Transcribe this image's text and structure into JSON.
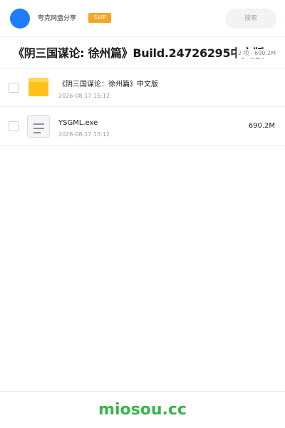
{
  "header": {
    "username": "夸克网盘分享",
    "badge": "SVIP",
    "search_placeholder": "搜索"
  },
  "folder": {
    "title": "《阴三国谋论: 徐州篇》Build.24726295中文版",
    "meta": "2 项 · 690.2M"
  },
  "files": [
    {
      "name": "《阴三国谋论：徐州篇》中文版",
      "date": "2026-08-17 15:12",
      "size": "",
      "icon": "folder-icon"
    },
    {
      "name": "YSGML.exe",
      "date": "2026-08-17 15:12",
      "size": "690.2M",
      "icon": "document-icon"
    }
  ],
  "footer": {
    "watermark": "miosou.cc"
  },
  "colors": {
    "avatar": "#1f7bff",
    "badge": "#f5a623",
    "folder": "#ffc21a",
    "watermark": "#39b54a"
  }
}
